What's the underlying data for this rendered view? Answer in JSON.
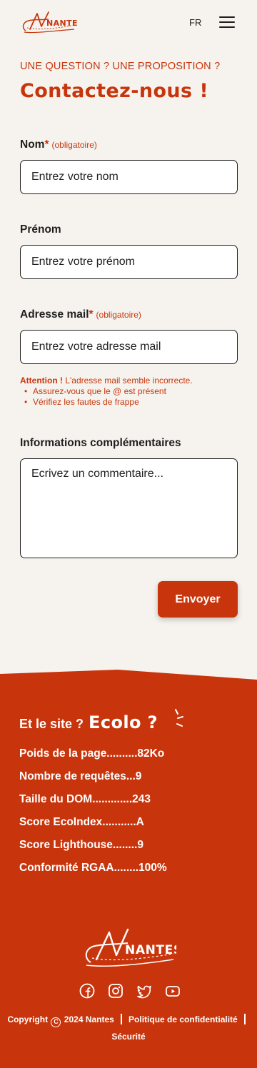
{
  "header": {
    "logo_text": "NANTES",
    "lang": "FR",
    "menu_icon": "hamburger-menu-icon"
  },
  "contact": {
    "eyebrow": "UNE QUESTION ? UNE PROPOSITION ?",
    "title": "Contactez-nous !",
    "fields": {
      "nom": {
        "label": "Nom",
        "star": "*",
        "required": "(obligatoire)",
        "placeholder": "Entrez votre nom"
      },
      "prenom": {
        "label": "Prénom",
        "placeholder": "Entrez votre prénom"
      },
      "mail": {
        "label": "Adresse mail",
        "star": "*",
        "required": "(obligatoire)",
        "placeholder": "Entrez votre adresse mail"
      },
      "comment": {
        "label": "Informations complémentaires",
        "placeholder": "Ecrivez un commentaire..."
      }
    },
    "error": {
      "strong": "Attention !",
      "message": " L'adresse mail semble incorrecte.",
      "tips": [
        "Assurez-vous que le @ est présent",
        "Vérifiez les fautes de frappe"
      ]
    },
    "submit_label": "Envoyer"
  },
  "eco": {
    "title_prefix": "Et le site ?",
    "title_big": "Ecolo ?",
    "stats": [
      "Poids de la page..........82Ko",
      "Nombre de requêtes...9",
      "Taille du DOM.............243",
      "Score EcoIndex...........A",
      "Score Lighthouse........9",
      "Conformité RGAA........100%"
    ]
  },
  "footer": {
    "logo_text": "NANTES",
    "socials": [
      "facebook-icon",
      "instagram-icon",
      "twitter-icon",
      "youtube-icon"
    ],
    "copyright_prefix": "Copyright",
    "copyright_symbol": "C",
    "copyright_suffix": "2024 Nantes",
    "privacy": "Politique de confidentialité",
    "security": "Sécurité"
  },
  "colors": {
    "accent": "#c8350c",
    "background": "#f6f3ee",
    "text": "#1e1e1e"
  }
}
